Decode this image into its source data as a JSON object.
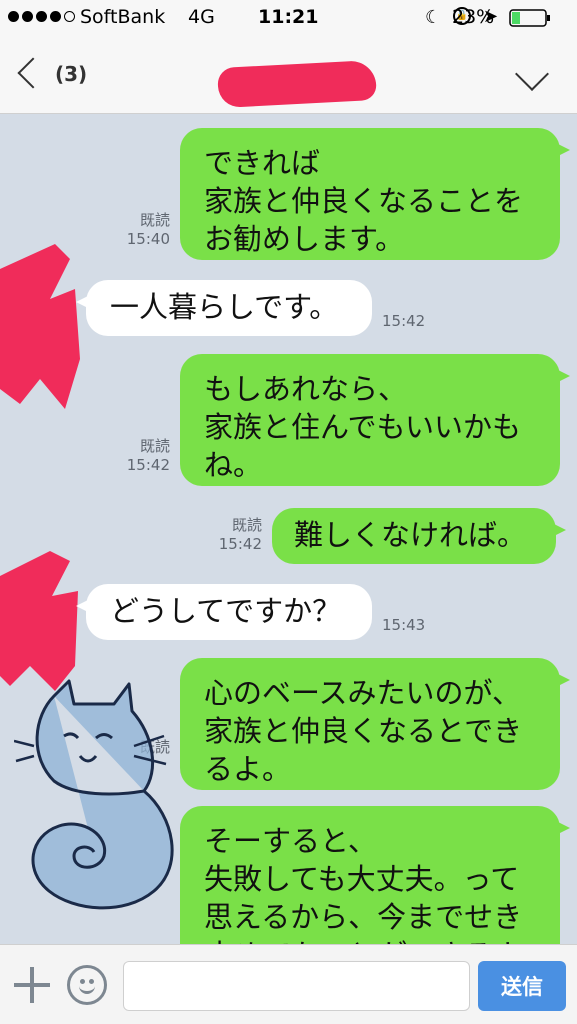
{
  "status_bar": {
    "carrier": "SoftBank",
    "network": "4G",
    "time": "11:21",
    "battery": "23%"
  },
  "header": {
    "unread_count": "(3)"
  },
  "messages": [
    {
      "direction": "out",
      "text": "できれば\n家族と仲良くなることを\nお勧めします。",
      "read": "既読",
      "time": "15:40"
    },
    {
      "direction": "in",
      "text": "一人暮らしです。",
      "time": "15:42"
    },
    {
      "direction": "out",
      "text": "もしあれなら、\n家族と住んでもいいかも\nね。",
      "read": "既読",
      "time": "15:42"
    },
    {
      "direction": "out",
      "text": "難しくなければ。",
      "read": "既読",
      "time": "15:42"
    },
    {
      "direction": "in",
      "text": "どうしてですか？",
      "time": "15:43"
    },
    {
      "direction": "out",
      "text": "心のベースみたいのが、\n家族と仲良くなるとでき\nるよ。",
      "read": "既読",
      "time": ""
    },
    {
      "direction": "out",
      "text": "そーすると、\n失敗しても大丈夫。って\n思えるから、今までせき\n止めてたことができるよ",
      "read": "",
      "time": ""
    }
  ],
  "input_bar": {
    "placeholder": "",
    "send_label": "送信"
  },
  "colors": {
    "chat_background": "#d4dce6",
    "outgoing_bubble": "#7ae048",
    "incoming_bubble": "#ffffff",
    "redaction": "#f02c5a",
    "send_button": "#4a90e2"
  },
  "icons": [
    "back-chevron-icon",
    "chevron-down-icon",
    "moon-icon",
    "rotation-lock-icon",
    "location-icon",
    "battery-icon",
    "plus-icon",
    "emoji-icon",
    "cat-sticker"
  ]
}
